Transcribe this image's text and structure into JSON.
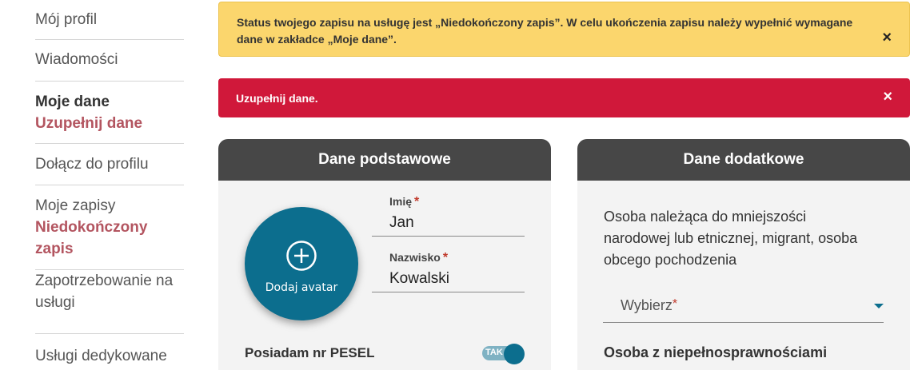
{
  "sidebar": {
    "items": [
      {
        "label": "Mój profil"
      },
      {
        "label": "Wiadomości"
      },
      {
        "label": "Moje dane",
        "sub": "Uzupełnij dane"
      },
      {
        "label": "Dołącz do profilu"
      },
      {
        "label": "Moje zapisy",
        "sub1": "Niedokończony",
        "sub2": "zapis"
      },
      {
        "label1": "Zapotrzebowanie na",
        "label2": "usługi"
      },
      {
        "label": "Usługi dedykowane"
      }
    ]
  },
  "alerts": {
    "warning": "Status twojego zapisu na usługę jest „Niedokończony zapis”. W celu ukończenia zapisu należy wypełnić wymagane dane w zakładce „Moje dane”.",
    "danger": "Uzupełnij dane.",
    "close": "×"
  },
  "basic": {
    "title": "Dane podstawowe",
    "avatar_label": "Dodaj avatar",
    "first_name_label": "Imię",
    "first_name_value": "Jan",
    "last_name_label": "Nazwisko",
    "last_name_value": "Kowalski",
    "required_mark": "*",
    "pesel_label": "Posiadam nr PESEL",
    "pesel_toggle": "TAK"
  },
  "additional": {
    "title": "Dane dodatkowe",
    "question1": "Osoba należąca do mniejszości narodowej lub etnicznej, migrant, osoba obcego pochodzenia",
    "select_placeholder": "Wybierz",
    "question2": "Osoba z niepełnosprawnościami"
  },
  "colors": {
    "accent": "#0c6e8e",
    "warning": "#fbd66d",
    "danger": "#d0183a",
    "header": "#474747",
    "sidebar_highlight": "#b35560"
  }
}
